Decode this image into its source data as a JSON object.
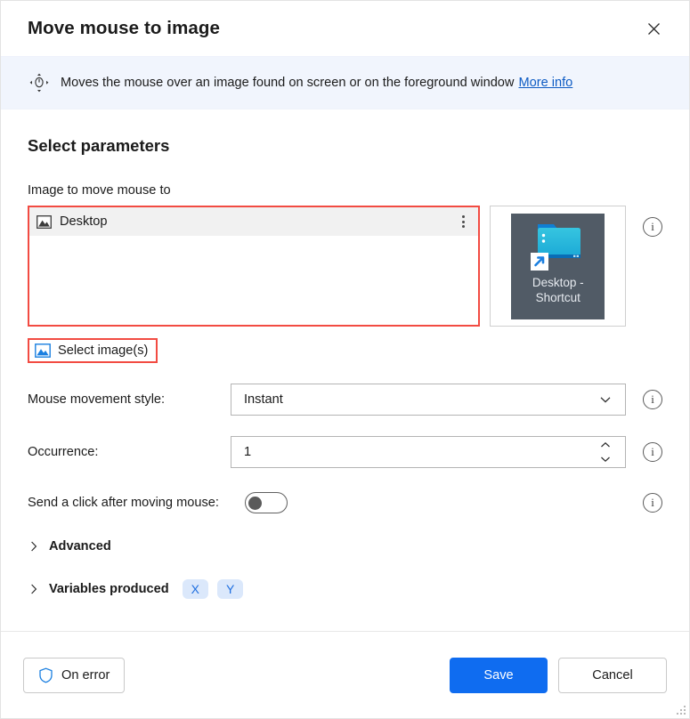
{
  "dialog": {
    "title": "Move mouse to image",
    "close_label": "Close"
  },
  "banner": {
    "icon": "move-mouse-icon",
    "text": "Moves the mouse over an image found on screen or on the foreground window",
    "link_label": "More info"
  },
  "parameters": {
    "section_title": "Select parameters",
    "image_field": {
      "label": "Image to move mouse to",
      "items": [
        {
          "icon": "image-icon",
          "label": "Desktop"
        }
      ],
      "menu_icon": "kebab-menu-icon",
      "select_button_label": "Select image(s)",
      "select_button_icon": "image-picker-icon",
      "thumbnail": {
        "icon": "folder-shortcut-icon",
        "caption_line1": "Desktop -",
        "caption_line2": "Shortcut"
      }
    },
    "rows": [
      {
        "label": "Mouse movement style:",
        "type": "dropdown",
        "value": "Instant",
        "options": [
          "Instant"
        ]
      },
      {
        "label": "Occurrence:",
        "type": "number",
        "value": "1"
      },
      {
        "label": "Send a click after moving mouse:",
        "type": "toggle",
        "value": "off"
      }
    ],
    "expanders": [
      {
        "label": "Advanced",
        "chips": []
      },
      {
        "label": "Variables produced",
        "chips": [
          "X",
          "Y"
        ]
      }
    ]
  },
  "footer": {
    "on_error_label": "On error",
    "on_error_icon": "shield-icon",
    "save_label": "Save",
    "cancel_label": "Cancel"
  },
  "colors": {
    "accent": "#0f6cf0",
    "highlight_box": "#f24b42",
    "banner_bg": "#f1f5fd",
    "link": "#0d5bc4",
    "chip_bg": "#dbe8fb",
    "chip_text": "#1f6fe0"
  }
}
